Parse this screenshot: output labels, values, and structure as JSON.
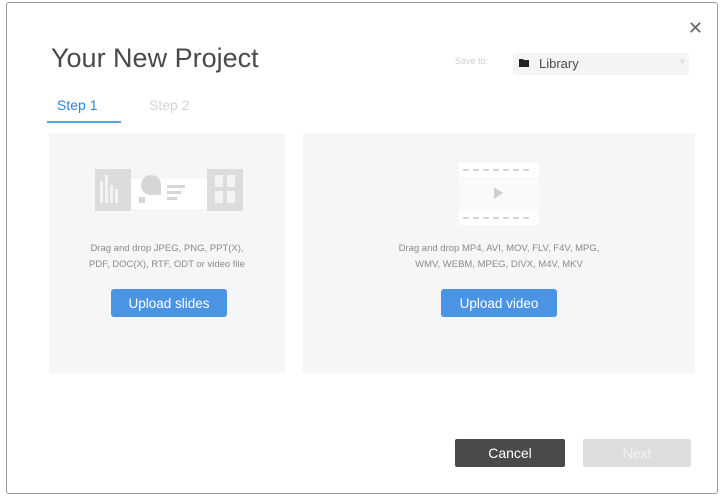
{
  "dialog": {
    "title": "Your New Project",
    "close_glyph": "✕"
  },
  "save_to": {
    "label": "Save to:",
    "folder_icon": "folder-icon",
    "folder": "Library",
    "chevron_icon": "chevron-down-icon"
  },
  "tabs": [
    {
      "label": "Step 1",
      "active": true
    },
    {
      "label": "Step 2",
      "active": false
    }
  ],
  "slides_panel": {
    "hint_line1": "Drag and drop JPEG, PNG, PPT(X),",
    "hint_line2": "PDF, DOC(X), RTF, ODT or video file",
    "button": "Upload slides"
  },
  "video_panel": {
    "hint_line1": "Drag and drop MP4, AVI, MOV, FLV, F4V, MPG,",
    "hint_line2": "WMV, WEBM, MPEG, DIVX, M4V, MKV",
    "button": "Upload video"
  },
  "footer": {
    "cancel": "Cancel",
    "next": "Next"
  },
  "colors": {
    "accent": "#4b93e3",
    "tab_active": "#2f80d8",
    "cancel_bg": "#4a4a4a",
    "next_disabled_bg": "#dddddd"
  }
}
